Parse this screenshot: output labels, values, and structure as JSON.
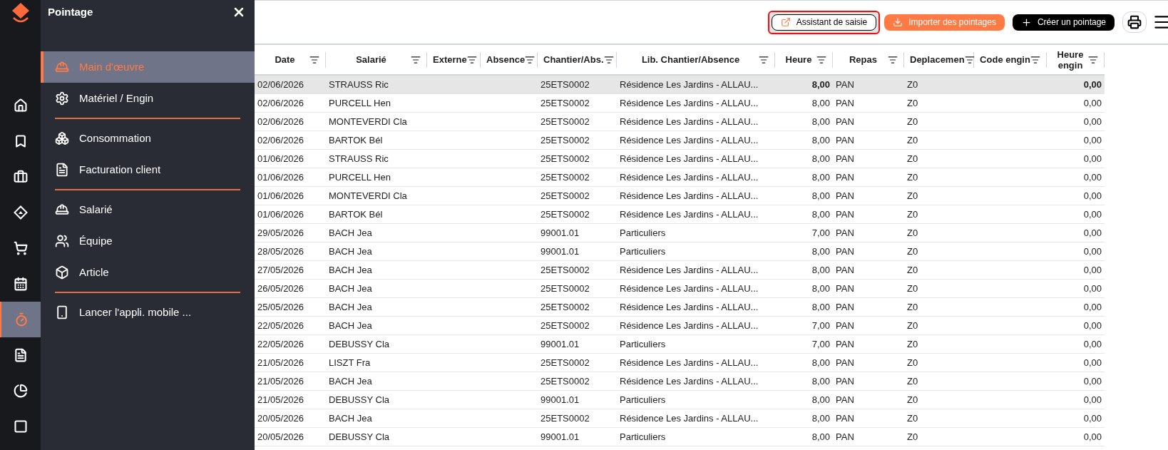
{
  "rail": [
    {
      "selected": false
    },
    {
      "selected": false
    },
    {
      "selected": false
    },
    {
      "selected": false
    },
    {
      "selected": false
    },
    {
      "selected": false
    },
    {
      "selected": true
    },
    {
      "selected": false
    },
    {
      "selected": false
    },
    {
      "selected": false
    }
  ],
  "panel": {
    "title": "Pointage",
    "groups": [
      [
        {
          "label": "Main d'œuvre",
          "selected": true
        },
        {
          "label": "Matériel / Engin",
          "selected": false
        }
      ],
      [
        {
          "label": "Consommation",
          "selected": false
        },
        {
          "label": "Facturation client",
          "selected": false
        }
      ],
      [
        {
          "label": "Salarié",
          "selected": false
        },
        {
          "label": "Équipe",
          "selected": false
        },
        {
          "label": "Article",
          "selected": false
        }
      ],
      [
        {
          "label": "Lancer l'appli. mobile ...",
          "selected": false
        }
      ]
    ]
  },
  "toolbar": {
    "buttons": [
      {
        "kind": "outline",
        "label": "Assistant de saisie",
        "focused": true
      },
      {
        "kind": "accent",
        "label": "Importer des pointages",
        "focused": false
      },
      {
        "kind": "dark",
        "label": "Créer un pointage",
        "focused": false
      },
      {
        "kind": "print",
        "focused": false
      }
    ]
  },
  "table": {
    "columns": [
      "Date",
      "Salarié",
      "Externe",
      "Absence",
      "Chantier/Abs.",
      "Lib. Chantier/Absence",
      "Heure",
      "Repas",
      "Deplacemen",
      "Code engin",
      "Heure engin"
    ],
    "rows": [
      {
        "date": "02/06/2026",
        "salarie": "STRAUSS Ric",
        "chantier": "25ETS0002",
        "lib": "Résidence Les Jardins - ALLAU...",
        "heure": "8,00",
        "repas": "PAN",
        "deplacement": "Z0",
        "heure_engin": "0,00",
        "selected": true
      },
      {
        "date": "02/06/2026",
        "salarie": "PURCELL Hen",
        "chantier": "25ETS0002",
        "lib": "Résidence Les Jardins - ALLAU...",
        "heure": "8,00",
        "repas": "PAN",
        "deplacement": "Z0",
        "heure_engin": "0,00",
        "selected": false
      },
      {
        "date": "02/06/2026",
        "salarie": "MONTEVERDI Cla",
        "chantier": "25ETS0002",
        "lib": "Résidence Les Jardins - ALLAU...",
        "heure": "8,00",
        "repas": "PAN",
        "deplacement": "Z0",
        "heure_engin": "0,00",
        "selected": false
      },
      {
        "date": "02/06/2026",
        "salarie": "BARTOK Bél",
        "chantier": "25ETS0002",
        "lib": "Résidence Les Jardins - ALLAU...",
        "heure": "8,00",
        "repas": "PAN",
        "deplacement": "Z0",
        "heure_engin": "0,00",
        "selected": false
      },
      {
        "date": "01/06/2026",
        "salarie": "STRAUSS Ric",
        "chantier": "25ETS0002",
        "lib": "Résidence Les Jardins - ALLAU...",
        "heure": "8,00",
        "repas": "PAN",
        "deplacement": "Z0",
        "heure_engin": "0,00",
        "selected": false
      },
      {
        "date": "01/06/2026",
        "salarie": "PURCELL Hen",
        "chantier": "25ETS0002",
        "lib": "Résidence Les Jardins - ALLAU...",
        "heure": "8,00",
        "repas": "PAN",
        "deplacement": "Z0",
        "heure_engin": "0,00",
        "selected": false
      },
      {
        "date": "01/06/2026",
        "salarie": "MONTEVERDI Cla",
        "chantier": "25ETS0002",
        "lib": "Résidence Les Jardins - ALLAU...",
        "heure": "8,00",
        "repas": "PAN",
        "deplacement": "Z0",
        "heure_engin": "0,00",
        "selected": false
      },
      {
        "date": "01/06/2026",
        "salarie": "BARTOK Bél",
        "chantier": "25ETS0002",
        "lib": "Résidence Les Jardins - ALLAU...",
        "heure": "8,00",
        "repas": "PAN",
        "deplacement": "Z0",
        "heure_engin": "0,00",
        "selected": false
      },
      {
        "date": "29/05/2026",
        "salarie": "BACH Jea",
        "chantier": "99001.01",
        "lib": "Particuliers",
        "heure": "7,00",
        "repas": "PAN",
        "deplacement": "Z0",
        "heure_engin": "0,00",
        "selected": false
      },
      {
        "date": "28/05/2026",
        "salarie": "BACH Jea",
        "chantier": "99001.01",
        "lib": "Particuliers",
        "heure": "8,00",
        "repas": "PAN",
        "deplacement": "Z0",
        "heure_engin": "0,00",
        "selected": false
      },
      {
        "date": "27/05/2026",
        "salarie": "BACH Jea",
        "chantier": "25ETS0002",
        "lib": "Résidence Les Jardins - ALLAU...",
        "heure": "8,00",
        "repas": "PAN",
        "deplacement": "Z0",
        "heure_engin": "0,00",
        "selected": false
      },
      {
        "date": "26/05/2026",
        "salarie": "BACH Jea",
        "chantier": "25ETS0002",
        "lib": "Résidence Les Jardins - ALLAU...",
        "heure": "8,00",
        "repas": "PAN",
        "deplacement": "Z0",
        "heure_engin": "0,00",
        "selected": false
      },
      {
        "date": "25/05/2026",
        "salarie": "BACH Jea",
        "chantier": "25ETS0002",
        "lib": "Résidence Les Jardins - ALLAU...",
        "heure": "8,00",
        "repas": "PAN",
        "deplacement": "Z0",
        "heure_engin": "0,00",
        "selected": false
      },
      {
        "date": "22/05/2026",
        "salarie": "BACH Jea",
        "chantier": "25ETS0002",
        "lib": "Résidence Les Jardins - ALLAU...",
        "heure": "7,00",
        "repas": "PAN",
        "deplacement": "Z0",
        "heure_engin": "0,00",
        "selected": false
      },
      {
        "date": "22/05/2026",
        "salarie": "DEBUSSY Cla",
        "chantier": "99001.01",
        "lib": "Particuliers",
        "heure": "7,00",
        "repas": "PAN",
        "deplacement": "Z0",
        "heure_engin": "0,00",
        "selected": false
      },
      {
        "date": "21/05/2026",
        "salarie": "LISZT Fra",
        "chantier": "25ETS0002",
        "lib": "Résidence Les Jardins - ALLAU...",
        "heure": "8,00",
        "repas": "PAN",
        "deplacement": "Z0",
        "heure_engin": "0,00",
        "selected": false
      },
      {
        "date": "21/05/2026",
        "salarie": "BACH Jea",
        "chantier": "25ETS0002",
        "lib": "Résidence Les Jardins - ALLAU...",
        "heure": "8,00",
        "repas": "PAN",
        "deplacement": "Z0",
        "heure_engin": "0,00",
        "selected": false
      },
      {
        "date": "21/05/2026",
        "salarie": "DEBUSSY Cla",
        "chantier": "99001.01",
        "lib": "Particuliers",
        "heure": "8,00",
        "repas": "PAN",
        "deplacement": "Z0",
        "heure_engin": "0,00",
        "selected": false
      },
      {
        "date": "20/05/2026",
        "salarie": "BACH Jea",
        "chantier": "25ETS0002",
        "lib": "Résidence Les Jardins - ALLAU...",
        "heure": "8,00",
        "repas": "PAN",
        "deplacement": "Z0",
        "heure_engin": "0,00",
        "selected": false
      },
      {
        "date": "20/05/2026",
        "salarie": "DEBUSSY Cla",
        "chantier": "99001.01",
        "lib": "Particuliers",
        "heure": "8,00",
        "repas": "PAN",
        "deplacement": "Z0",
        "heure_engin": "0,00",
        "selected": false
      }
    ]
  }
}
